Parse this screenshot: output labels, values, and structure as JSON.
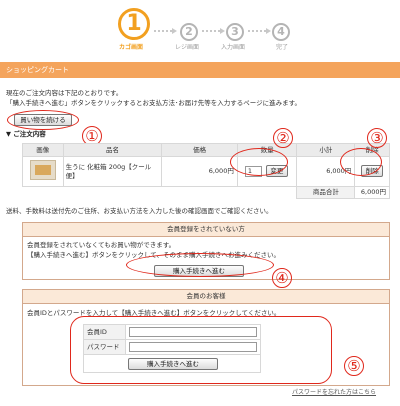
{
  "steps": [
    {
      "number": "1",
      "label": "カゴ画面",
      "active": true
    },
    {
      "number": "2",
      "label": "レジ画面",
      "active": false
    },
    {
      "number": "3",
      "label": "入力画面",
      "active": false
    },
    {
      "number": "4",
      "label": "完了",
      "active": false
    }
  ],
  "header": {
    "title": "ショッピングカート"
  },
  "intro": {
    "line1": "現在のご注文内容は下記のとおりです。",
    "line2": "「購入手続きへ進む」ボタンをクリックするとお支払方法･お届け先等を入力するページに進みます。",
    "continue_shopping": "買い物を続ける"
  },
  "order": {
    "section_title": "▼ ご注文内容",
    "columns": [
      "画像",
      "品名",
      "価格",
      "数量",
      "小計",
      "削除"
    ],
    "items": [
      {
        "name": "生うに 化粧箱 200g【クール便】",
        "price": "6,000円",
        "quantity": "1",
        "update_label": "変更",
        "subtotal": "6,000円",
        "delete_label": "削除"
      }
    ],
    "total_label": "商品合計",
    "total_value": "6,000円"
  },
  "shipping_note": "送料、手数料は送付先のご住所、お支払い方法を入力した後の確認画面でご確認ください。",
  "guest": {
    "title": "会員登録をされていない方",
    "line1": "会員登録をされていなくてもお買い物ができます。",
    "line2": "【購入手続きへ進む】ボタンをクリックして、そのまま購入手続きへお進みください。",
    "button": "購入手続きへ進む"
  },
  "member": {
    "title": "会員のお客様",
    "instruction": "会員IDとパスワードを入力して【購入手続きへ進む】ボタンをクリックしてください。",
    "id_label": "会員ID",
    "password_label": "パスワード",
    "button": "購入手続きへ進む",
    "forgot_password": "パスワードを忘れた方はこちら"
  },
  "annotations": [
    "①",
    "②",
    "③",
    "④",
    "⑤"
  ],
  "colors": {
    "accent": "#f2a020",
    "header_bar": "#f4a45c",
    "annotation_red": "#e0281c",
    "panel_border": "#d3a88c"
  }
}
